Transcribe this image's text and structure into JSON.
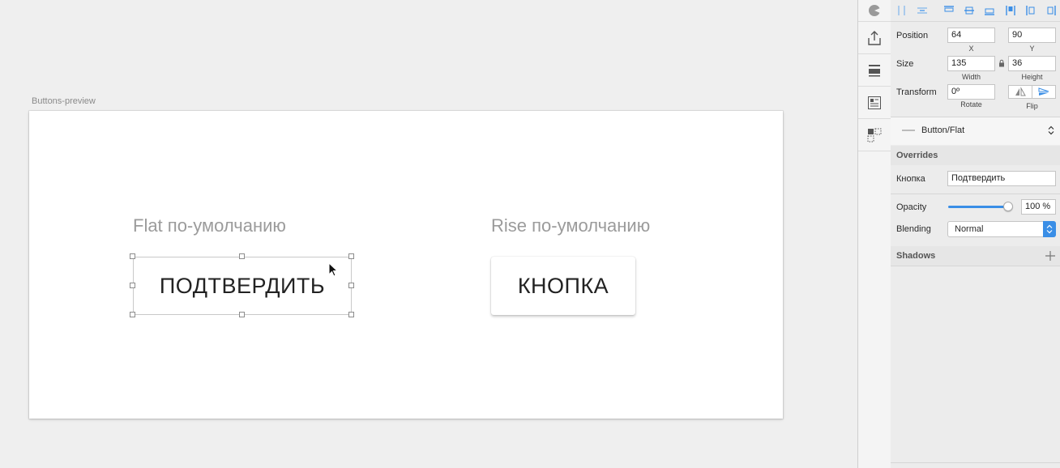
{
  "canvas": {
    "artboard_name": "Buttons-preview",
    "flat_caption": "Flat по-умолчанию",
    "rise_caption": "Rise по-умолчанию",
    "flat_button_label": "ПОДТВЕРДИТЬ",
    "rise_button_label": "КНОПКА"
  },
  "inspector": {
    "position": {
      "label": "Position",
      "x": "64",
      "y": "90",
      "x_caption": "X",
      "y_caption": "Y"
    },
    "size": {
      "label": "Size",
      "width": "135",
      "height": "36",
      "width_caption": "Width",
      "height_caption": "Height"
    },
    "transform": {
      "label": "Transform",
      "rotate": "0º",
      "rotate_caption": "Rotate",
      "flip_caption": "Flip"
    },
    "symbol": {
      "name": "Button/Flat"
    },
    "overrides": {
      "title": "Overrides",
      "field_label": "Кнопка",
      "field_value": "Подтвердить"
    },
    "opacity": {
      "label": "Opacity",
      "value": "100 %",
      "level": 1.0
    },
    "blending": {
      "label": "Blending",
      "value": "Normal"
    },
    "shadows": {
      "title": "Shadows"
    }
  },
  "toolbar_icons": [
    "palette-icon",
    "export-icon",
    "layer-style-icon",
    "text-style-icon",
    "symbol-icon"
  ],
  "colors": {
    "accent": "#3a8ee6",
    "canvas_bg": "#efefef",
    "artboard_bg": "#ffffff"
  }
}
